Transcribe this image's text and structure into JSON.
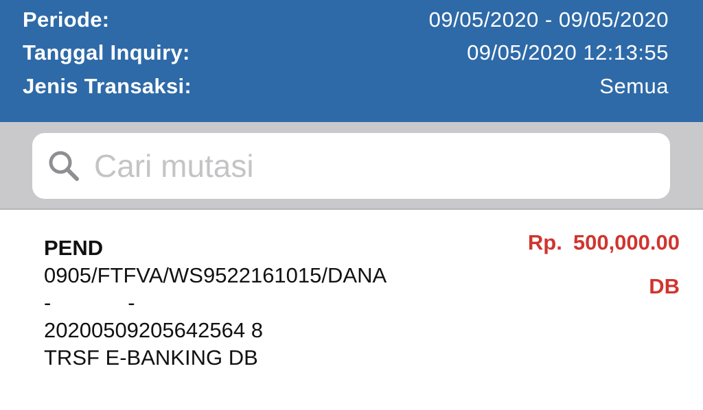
{
  "info": {
    "periode_label": "Periode:",
    "periode_value": "09/05/2020 - 09/05/2020",
    "tanggal_label": "Tanggal Inquiry:",
    "tanggal_value": "09/05/2020 12:13:55",
    "jenis_label": "Jenis Transaksi:",
    "jenis_value": "Semua"
  },
  "search": {
    "placeholder": "Cari mutasi",
    "value": "",
    "icon": "search-icon"
  },
  "transactions": [
    {
      "status": "PEND",
      "description_lines": [
        "0905/FTFVA/WS9522161015/DANA",
        "-             -",
        "20200509205642564 8",
        "TRSF E-BANKING DB"
      ],
      "currency": "Rp.",
      "amount": "500,000.00",
      "dc": "DB"
    }
  ],
  "colors": {
    "header_bg": "#2e6aa8",
    "header_text": "#ffffff",
    "search_band_bg": "#c9c9cb",
    "amount": "#d0352f"
  }
}
